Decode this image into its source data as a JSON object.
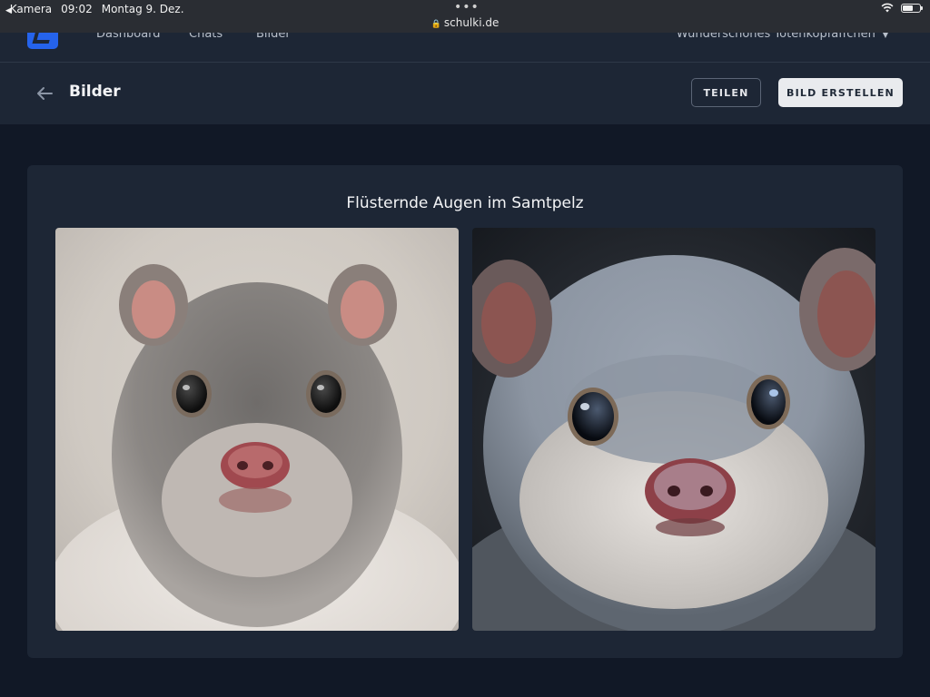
{
  "status_bar": {
    "back_app": "Kamera",
    "time": "09:02",
    "date": "Montag 9. Dez.",
    "url": "schulki.de"
  },
  "nav": {
    "links": [
      "Dashboard",
      "Chats",
      "Bilder"
    ],
    "user": "Wunderschönes Totenkopfäffchen"
  },
  "header": {
    "title": "Bilder",
    "share_label": "TEILEN",
    "create_label": "BILD ERSTELLEN"
  },
  "card": {
    "title": "Flüsternde Augen im Samtpelz"
  },
  "colors": {
    "background": "#111826",
    "surface": "#1d2635",
    "accent": "#2563eb"
  }
}
